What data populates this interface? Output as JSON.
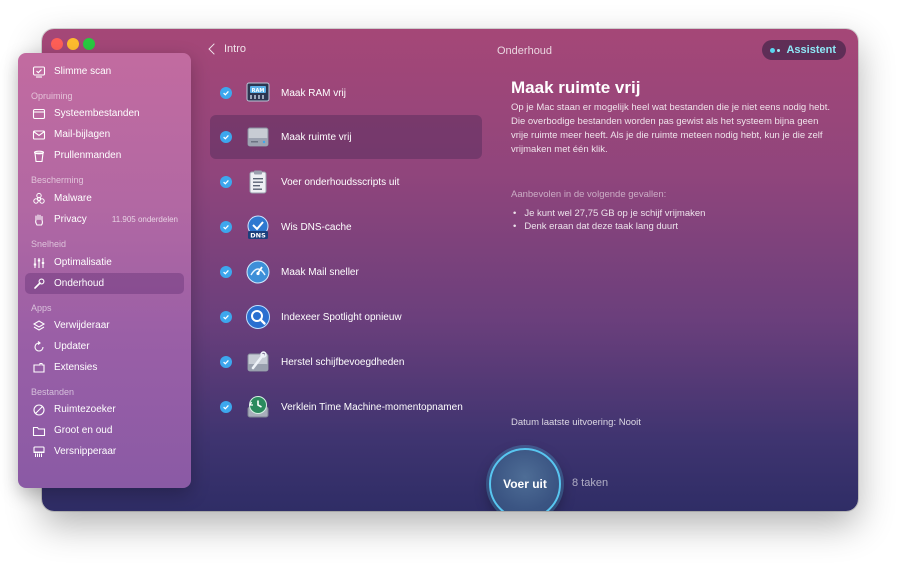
{
  "window": {
    "title": "Onderhoud",
    "back_label": "Intro",
    "assistant_label": "Assistent"
  },
  "sidebar": {
    "top_item": {
      "label": "Slimme scan",
      "icon": "smart-scan-icon"
    },
    "sections": [
      {
        "header": "Opruiming",
        "items": [
          {
            "label": "Systeembestanden",
            "icon": "system-junk-icon"
          },
          {
            "label": "Mail-bijlagen",
            "icon": "mail-attachments-icon"
          },
          {
            "label": "Prullenmanden",
            "icon": "trash-bin-icon"
          }
        ]
      },
      {
        "header": "Bescherming",
        "items": [
          {
            "label": "Malware",
            "icon": "biohazard-icon"
          },
          {
            "label": "Privacy",
            "icon": "hand-icon",
            "extra": "11.905 onderdelen"
          }
        ]
      },
      {
        "header": "Snelheid",
        "items": [
          {
            "label": "Optimalisatie",
            "icon": "sliders-icon"
          },
          {
            "label": "Onderhoud",
            "icon": "wrench-icon",
            "active": true
          }
        ]
      },
      {
        "header": "Apps",
        "items": [
          {
            "label": "Verwijderaar",
            "icon": "uninstaller-icon"
          },
          {
            "label": "Updater",
            "icon": "updater-icon"
          },
          {
            "label": "Extensies",
            "icon": "extensions-icon"
          }
        ]
      },
      {
        "header": "Bestanden",
        "items": [
          {
            "label": "Ruimtezoeker",
            "icon": "space-lens-icon"
          },
          {
            "label": "Groot en oud",
            "icon": "folder-icon"
          },
          {
            "label": "Versnipperaar",
            "icon": "shredder-icon"
          }
        ]
      }
    ]
  },
  "tasks": [
    {
      "label": "Maak RAM vrij",
      "icon": "ram-chip-icon",
      "checked": true
    },
    {
      "label": "Maak ruimte vrij",
      "icon": "hard-drive-icon",
      "checked": true,
      "selected": true
    },
    {
      "label": "Voer onderhoudsscripts uit",
      "icon": "clipboard-script-icon",
      "checked": true
    },
    {
      "label": "Wis DNS-cache",
      "icon": "dns-icon",
      "checked": true,
      "badge": "DNS"
    },
    {
      "label": "Maak Mail sneller",
      "icon": "mail-speedup-icon",
      "checked": true
    },
    {
      "label": "Indexeer Spotlight opnieuw",
      "icon": "spotlight-search-icon",
      "checked": true
    },
    {
      "label": "Herstel schijfbevoegdheden",
      "icon": "disk-repair-icon",
      "checked": true
    },
    {
      "label": "Verklein Time Machine-momentopnamen",
      "icon": "time-machine-icon",
      "checked": true
    }
  ],
  "detail": {
    "title": "Maak ruimte vrij",
    "description": "Op je Mac staan er mogelijk heel wat bestanden die je niet eens nodig hebt. Die overbodige bestanden worden pas gewist als het systeem bijna geen vrije ruimte meer heeft. Als je die ruimte meteen nodig hebt, kun je die zelf vrijmaken met één klik.",
    "recommended_header": "Aanbevolen in de volgende gevallen:",
    "bullets": [
      "Je kunt wel 27,75 GB op je schijf vrijmaken",
      "Denk eraan dat deze taak lang duurt"
    ],
    "last_run": "Datum laatste uitvoering:  Nooit"
  },
  "footer": {
    "run_label": "Voer uit",
    "task_count": "8 taken"
  },
  "colors": {
    "accent": "#3da7ee",
    "assistant_text": "#8ee8f6",
    "run_button_ring": "#58c6f0"
  }
}
